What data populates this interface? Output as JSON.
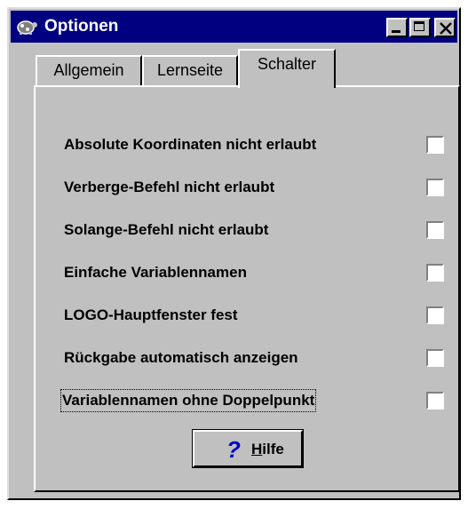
{
  "window": {
    "title": "Optionen"
  },
  "tabs": [
    {
      "label": "Allgemein",
      "active": false
    },
    {
      "label": "Lernseite",
      "active": false
    },
    {
      "label": "Schalter",
      "active": true
    }
  ],
  "options": [
    {
      "label": "Absolute Koordinaten nicht erlaubt",
      "checked": false
    },
    {
      "label": "Verberge-Befehl nicht erlaubt",
      "checked": false
    },
    {
      "label": "Solange-Befehl nicht erlaubt",
      "checked": false
    },
    {
      "label": "Einfache Variablennamen",
      "checked": false
    },
    {
      "label": "LOGO-Hauptfenster fest",
      "checked": false
    },
    {
      "label": "Rückgabe automatisch anzeigen",
      "checked": false
    },
    {
      "label": "Variablennamen ohne Doppelpunkt",
      "checked": false,
      "focused": true
    }
  ],
  "help_button": {
    "icon": "?",
    "label": "Hilfe"
  },
  "colors": {
    "titlebar": "#000080",
    "face": "#c0c0c0",
    "help_icon": "#0000cc"
  }
}
